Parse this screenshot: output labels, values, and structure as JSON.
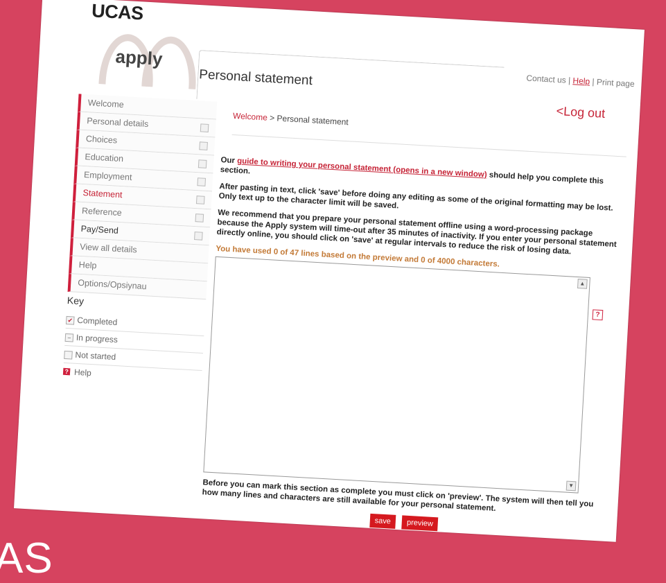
{
  "background_text": "AS",
  "brand": {
    "logo": "UCAS",
    "app_name": "apply"
  },
  "header": {
    "page_title": "Personal statement",
    "links": {
      "contact": "Contact us",
      "sep1": " | ",
      "help": "Help",
      "sep2": " | ",
      "print": "Print page"
    },
    "logout": "<Log out"
  },
  "nav": {
    "items": [
      {
        "label": "Welcome",
        "check": false,
        "style": "normal"
      },
      {
        "label": "Personal details",
        "check": true,
        "style": "normal"
      },
      {
        "label": "Choices",
        "check": true,
        "style": "normal"
      },
      {
        "label": "Education",
        "check": true,
        "style": "normal"
      },
      {
        "label": "Employment",
        "check": true,
        "style": "normal"
      },
      {
        "label": "Statement",
        "check": true,
        "style": "active"
      },
      {
        "label": "Reference",
        "check": true,
        "style": "normal"
      },
      {
        "label": "Pay/Send",
        "check": true,
        "style": "dark"
      },
      {
        "label": "View all details",
        "check": false,
        "style": "normal"
      },
      {
        "label": "Help",
        "check": false,
        "style": "normal"
      },
      {
        "label": "Options/Opsiynau",
        "check": false,
        "style": "normal"
      }
    ]
  },
  "key": {
    "title": "Key",
    "items": [
      {
        "label": "Completed",
        "icon": "check-icon",
        "glyph": "✔"
      },
      {
        "label": "In progress",
        "icon": "in-progress-icon",
        "glyph": "−"
      },
      {
        "label": "Not started",
        "icon": "not-started-icon",
        "glyph": ""
      },
      {
        "label": "Help",
        "icon": "help-icon",
        "glyph": "?"
      }
    ]
  },
  "breadcrumb": {
    "home": "Welcome",
    "separator": " > ",
    "current": "Personal statement"
  },
  "content": {
    "intro_before": "Our ",
    "intro_link": "guide to writing your personal statement (opens in a new window)",
    "intro_after": " should help you complete this section.",
    "paste_note": "After pasting in text, click 'save' before doing any editing as some of the original formatting may be lost. Only text up to the character limit will be saved.",
    "offline_note": "We recommend that you prepare your personal statement offline using a word-processing package because the Apply system will time-out after 35 minutes of inactivity. If you enter your personal statement directly online, you should click on 'save' at regular intervals to reduce the risk of losing data.",
    "counter": "You have used 0 of 47 lines based on the preview and 0 of 4000 characters.",
    "editor_value": "",
    "help_glyph": "?",
    "bottom_note": "Before you can mark this section as complete you must click on 'preview'. The system will then tell you how many lines and characters are still available for your personal statement."
  },
  "buttons": {
    "save": "save",
    "preview": "preview"
  },
  "colors": {
    "background": "#d6435f",
    "accent": "#cf1f3c",
    "link": "#c62437",
    "counter": "#c37a37",
    "button": "#d5191f"
  }
}
